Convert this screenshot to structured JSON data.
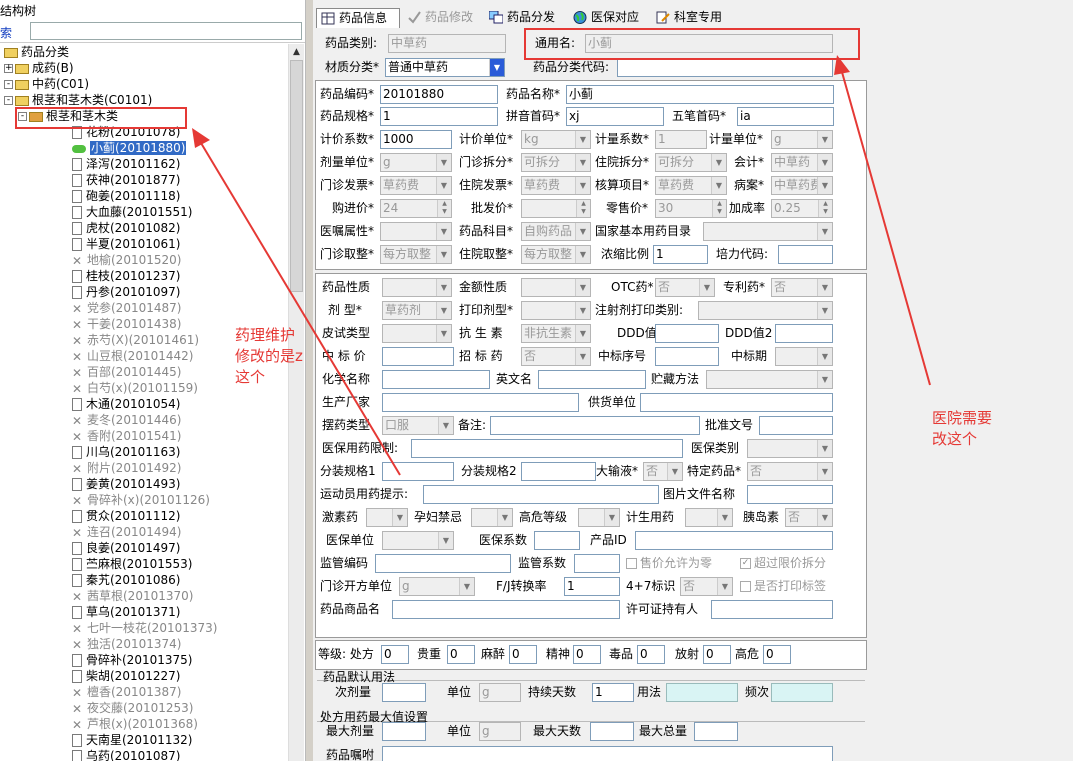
{
  "left": {
    "title": "结构树",
    "search_label": "索"
  },
  "tree": [
    {
      "t": "药品分类",
      "kind": "root",
      "ind": 0
    },
    {
      "t": "成药(B)",
      "kind": "folder",
      "ind": 1,
      "ex": "+"
    },
    {
      "t": "中药(C01)",
      "kind": "folder",
      "ind": 1,
      "ex": "-"
    },
    {
      "t": "根茎和茎木类(C0101)",
      "kind": "folder",
      "ind": 2,
      "ex": "-"
    },
    {
      "t": "根茎和茎木类",
      "kind": "node",
      "ind": 3,
      "ex": "-"
    },
    {
      "t": "花粉(20101078)",
      "kind": "doc",
      "ind": 5
    },
    {
      "t": "小蓟(20101880)",
      "kind": "pill",
      "ind": 5,
      "sel": true
    },
    {
      "t": "泽泻(20101162)",
      "kind": "doc",
      "ind": 5
    },
    {
      "t": "茯神(20101877)",
      "kind": "doc",
      "ind": 5
    },
    {
      "t": "砲姜(20101118)",
      "kind": "doc",
      "ind": 5
    },
    {
      "t": "大血藤(20101551)",
      "kind": "doc",
      "ind": 5
    },
    {
      "t": "虎杖(20101082)",
      "kind": "doc",
      "ind": 5
    },
    {
      "t": "半夏(20101061)",
      "kind": "doc",
      "ind": 5
    },
    {
      "t": "地榆(20101520)",
      "kind": "x",
      "ind": 5
    },
    {
      "t": "桂枝(20101237)",
      "kind": "doc",
      "ind": 5
    },
    {
      "t": "丹参(20101097)",
      "kind": "doc",
      "ind": 5
    },
    {
      "t": "党参(20101487)",
      "kind": "x",
      "ind": 5
    },
    {
      "t": "干姜(20101438)",
      "kind": "x",
      "ind": 5
    },
    {
      "t": "赤芍(X)(20101461)",
      "kind": "x",
      "ind": 5
    },
    {
      "t": "山豆根(20101442)",
      "kind": "x",
      "ind": 5
    },
    {
      "t": "百部(20101445)",
      "kind": "x",
      "ind": 5
    },
    {
      "t": "白芍(x)(20101159)",
      "kind": "x",
      "ind": 5
    },
    {
      "t": "木通(20101054)",
      "kind": "doc",
      "ind": 5
    },
    {
      "t": "麦冬(20101446)",
      "kind": "x",
      "ind": 5
    },
    {
      "t": "香附(20101541)",
      "kind": "x",
      "ind": 5
    },
    {
      "t": "川乌(20101163)",
      "kind": "doc",
      "ind": 5
    },
    {
      "t": "附片(20101492)",
      "kind": "x",
      "ind": 5
    },
    {
      "t": "姜黄(20101493)",
      "kind": "doc",
      "ind": 5
    },
    {
      "t": "骨碎补(x)(20101126)",
      "kind": "x",
      "ind": 5
    },
    {
      "t": "贯众(20101112)",
      "kind": "doc",
      "ind": 5
    },
    {
      "t": "连召(20101494)",
      "kind": "x",
      "ind": 5
    },
    {
      "t": "良姜(20101497)",
      "kind": "doc",
      "ind": 5
    },
    {
      "t": "苎麻根(20101553)",
      "kind": "doc",
      "ind": 5
    },
    {
      "t": "秦艽(20101086)",
      "kind": "doc",
      "ind": 5
    },
    {
      "t": "茜草根(20101370)",
      "kind": "x",
      "ind": 5
    },
    {
      "t": "草乌(20101371)",
      "kind": "doc",
      "ind": 5
    },
    {
      "t": "七叶一枝花(20101373)",
      "kind": "x",
      "ind": 5
    },
    {
      "t": "独活(20101374)",
      "kind": "x",
      "ind": 5
    },
    {
      "t": "骨碎补(20101375)",
      "kind": "doc",
      "ind": 5
    },
    {
      "t": "柴胡(20101227)",
      "kind": "doc",
      "ind": 5
    },
    {
      "t": "檀香(20101387)",
      "kind": "x",
      "ind": 5
    },
    {
      "t": "夜交藤(20101253)",
      "kind": "x",
      "ind": 5
    },
    {
      "t": "芦根(x)(20101368)",
      "kind": "x",
      "ind": 5
    },
    {
      "t": "天南星(20101132)",
      "kind": "doc",
      "ind": 5
    },
    {
      "t": "乌药(20101087)",
      "kind": "doc",
      "ind": 5
    }
  ],
  "tabs": [
    "药品信息",
    "药品修改",
    "药品分发",
    "医保对应",
    "科室专用"
  ],
  "form": {
    "category_label": "药品类别:",
    "category_value": "中草药",
    "generic_label": "通用名:",
    "generic_value": "小蓟",
    "material_label": "材质分类*",
    "material_value": "普通中草药",
    "code_label": "药品分类代码:",
    "drug_code_label": "药品编码*",
    "drug_code": "20101880",
    "drug_name_label": "药品名称*",
    "drug_name": "小蓟",
    "spec_label": "药品规格*",
    "spec": "1",
    "pinyin_label": "拼音首码*",
    "pinyin": "xj",
    "wubi_label": "五笔首码*",
    "wubi": "ia",
    "price_coef_label": "计价系数*",
    "price_coef": "1000",
    "price_unit_label": "计价单位*",
    "price_unit": "kg",
    "measure_coef_label": "计量系数*",
    "measure_coef": "1",
    "measure_unit_label": "计量单位*",
    "measure_unit": "g",
    "dose_unit_label": "剂量单位*",
    "dose_unit": "g",
    "op_split_label": "门诊拆分*",
    "op_split": "可拆分",
    "ip_split_label": "住院拆分*",
    "ip_split": "可拆分",
    "acct_label": "会计*",
    "acct": "中草药",
    "op_inv_label": "门诊发票*",
    "op_inv": "草药费",
    "ip_inv_label": "住院发票*",
    "ip_inv": "草药费",
    "audit_label": "核算项目*",
    "audit": "草药费",
    "case_label": "病案*",
    "case": "中草药费",
    "buy_label": "购进价*",
    "buy": "24",
    "wholesale_label": "批发价*",
    "retail_label": "零售价*",
    "retail": "30",
    "markup_label": "加成率",
    "markup": "0.25",
    "order_attr_label": "医嘱属性*",
    "subject_label": "药品科目*",
    "subject": "自购药品",
    "basic_label": "国家基本用药目录",
    "op_take_label": "门诊取整*",
    "op_take": "每方取整",
    "ip_take_label": "住院取整*",
    "ip_take": "每方取整",
    "ratio_label": "浓缩比例",
    "ratio": "1",
    "peili_label": "培力代码:",
    "nature_label": "药品性质",
    "amount_label": "金额性质",
    "otc_label": "OTC药*",
    "otc": "否",
    "patent_label": "专利药*",
    "patent": "否",
    "form_label": "剂 型*",
    "form": "草药剂",
    "print_form_label": "打印剂型*",
    "inject_label": "注射剂打印类别:",
    "skin_label": "皮试类型",
    "anti_label": "抗 生 素",
    "anti": "非抗生素",
    "ddd_label": "DDD值",
    "ddd2_label": "DDD值2",
    "bid_price_label": "中 标 价",
    "bid_label": "招 标 药",
    "bid": "否",
    "bid_no_label": "中标序号",
    "bid_period_label": "中标期",
    "chem_label": "化学名称",
    "en_label": "英文名",
    "store_label": "贮藏方法",
    "maker_label": "生产厂家",
    "supplier_label": "供货单位",
    "place_label": "摆药类型",
    "place": "口服",
    "note_label": "备注:",
    "approve_label": "批准文号",
    "ins_limit_label": "医保用药限制:",
    "ins_type_label": "医保类别",
    "pack1_label": "分装规格1",
    "pack2_label": "分装规格2",
    "infusion_label": "大输液*",
    "infusion": "否",
    "special_label": "特定药品*",
    "special": "否",
    "athlete_label": "运动员用药提示:",
    "img_label": "图片文件名称",
    "hormone_label": "激素药",
    "preg_label": "孕妇禁忌",
    "risk_label": "高危等级",
    "birth_label": "计生用药",
    "insulin_label": "胰岛素",
    "insulin": "否",
    "ins_unit_label": "医保单位",
    "ins_coef_label": "医保系数",
    "pid_label": "产品ID",
    "sup_code_label": "监管编码",
    "sup_coef_label": "监管系数",
    "allow_zero_label": "售价允许为零",
    "over_split_label": "超过限价拆分",
    "op_rx_unit_label": "门诊开方单位",
    "op_rx_unit": "g",
    "fj_label": "F/J转换率",
    "fj": "1",
    "p47_label": "4+7标识",
    "p47": "否",
    "print_label_label": "是否打印标签",
    "brand_label": "药品商品名",
    "license_label": "许可证持有人",
    "level_label": "等级: 处方",
    "level_rx": "0",
    "expensive_label": "贵重",
    "expensive": "0",
    "narcotic_label": "麻醉",
    "narcotic": "0",
    "mental_label": "精神",
    "mental": "0",
    "poison_label": "毒品",
    "poison": "0",
    "radio_label": "放射",
    "radio": "0",
    "danger_label": "高危",
    "danger": "0",
    "default_title": "药品默认用法",
    "dose_label": "次剂量",
    "unit_label": "单位",
    "unit": "g",
    "days_label": "持续天数",
    "days": "1",
    "usage_label": "用法",
    "freq_label": "频次",
    "max_title": "处方用药最大值设置",
    "max_dose_label": "最大剂量",
    "max_unit_label": "单位",
    "max_unit": "g",
    "max_days_label": "最大天数",
    "max_total_label": "最大总量",
    "tips_label": "药品嘱咐"
  },
  "annotations": {
    "left_note": "药理维护\n修改的是z\n这个",
    "right_note": "医院需要\n改这个",
    "color": "#e53935"
  }
}
